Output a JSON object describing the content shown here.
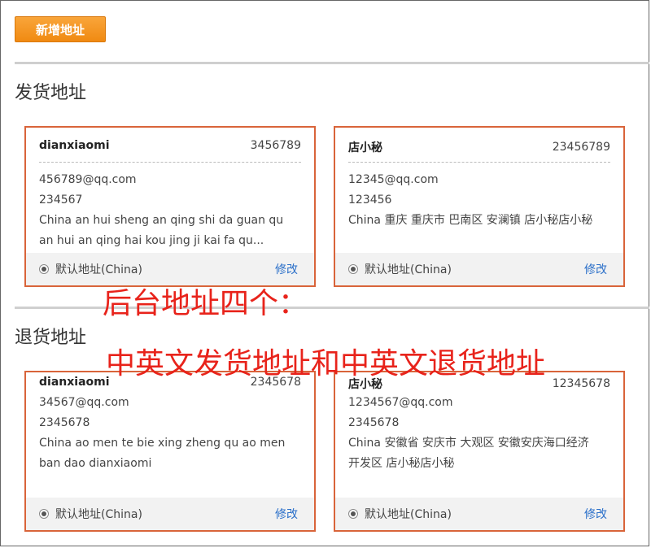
{
  "toolbar": {
    "add_label": "新增地址"
  },
  "shipping": {
    "title": "发货地址",
    "cards": [
      {
        "name": "dianxiaomi",
        "phone": "3456789",
        "email": "456789@qq.com",
        "zip": "234567",
        "address_line1": "China an hui sheng an qing shi da guan qu",
        "address_line2": "an hui an qing hai kou jing ji kai fa qu...",
        "default_label": "默认地址(China)",
        "edit_label": "修改"
      },
      {
        "name": "店小秘",
        "phone": "23456789",
        "email": "12345@qq.com",
        "zip": "123456",
        "address_line1": "China 重庆 重庆市 巴南区 安澜镇 店小秘店小秘",
        "address_line2": "",
        "default_label": "默认地址(China)",
        "edit_label": "修改"
      }
    ]
  },
  "returns": {
    "title": "退货地址",
    "cards": [
      {
        "name": "dianxiaomi",
        "phone": "2345678",
        "email": "34567@qq.com",
        "zip": "2345678",
        "address_line1": "China ao men te bie xing zheng qu ao men",
        "address_line2": "ban dao dianxiaomi",
        "default_label": "默认地址(China)",
        "edit_label": "修改"
      },
      {
        "name": "店小秘",
        "phone": "12345678",
        "email": "1234567@qq.com",
        "zip": "2345678",
        "address_line1": "China 安徽省 安庆市 大观区 安徽安庆海口经济",
        "address_line2": "开发区 店小秘店小秘",
        "default_label": "默认地址(China)",
        "edit_label": "修改"
      }
    ]
  },
  "annotation": {
    "line1": "后台地址四个：",
    "line2": "中英文发货地址和中英文退货地址",
    "color": "#e8231b"
  },
  "colors": {
    "card_border": "#d9643a",
    "button": "#f08a12",
    "link": "#2a6fc9"
  }
}
